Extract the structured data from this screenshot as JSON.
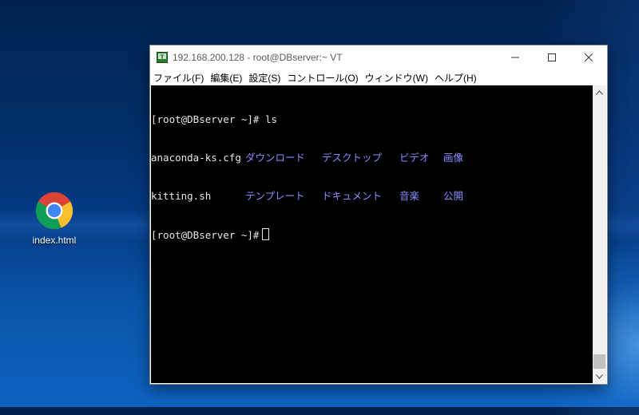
{
  "desktop": {
    "icons": [
      {
        "label": "index.html",
        "icon": "chrome-icon"
      }
    ]
  },
  "window": {
    "title": "192.168.200.128 - root@DBserver:~ VT",
    "menu": [
      "ファイル(F)",
      "編集(E)",
      "設定(S)",
      "コントロール(O)",
      "ウィンドウ(W)",
      "ヘルプ(H)"
    ],
    "controls": [
      "minimize",
      "maximize",
      "close"
    ]
  },
  "terminal": {
    "prompt1": "[root@DBserver ~]# ls",
    "files": [
      {
        "name": "anaconda-ks.cfg",
        "type": "file"
      },
      {
        "name": "ダウンロード",
        "type": "dir"
      },
      {
        "name": "デスクトップ",
        "type": "dir"
      },
      {
        "name": "ビデオ",
        "type": "dir"
      },
      {
        "name": "画像",
        "type": "dir"
      },
      {
        "name": "kitting.sh",
        "type": "file"
      },
      {
        "name": "テンプレート",
        "type": "dir"
      },
      {
        "name": "ドキュメント",
        "type": "dir"
      },
      {
        "name": "音楽",
        "type": "dir"
      },
      {
        "name": "公開",
        "type": "dir"
      }
    ],
    "prompt2": "[root@DBserver ~]#",
    "colors": {
      "text": "#e6e6e6",
      "directory": "#8b8bff",
      "background": "#000000"
    }
  }
}
